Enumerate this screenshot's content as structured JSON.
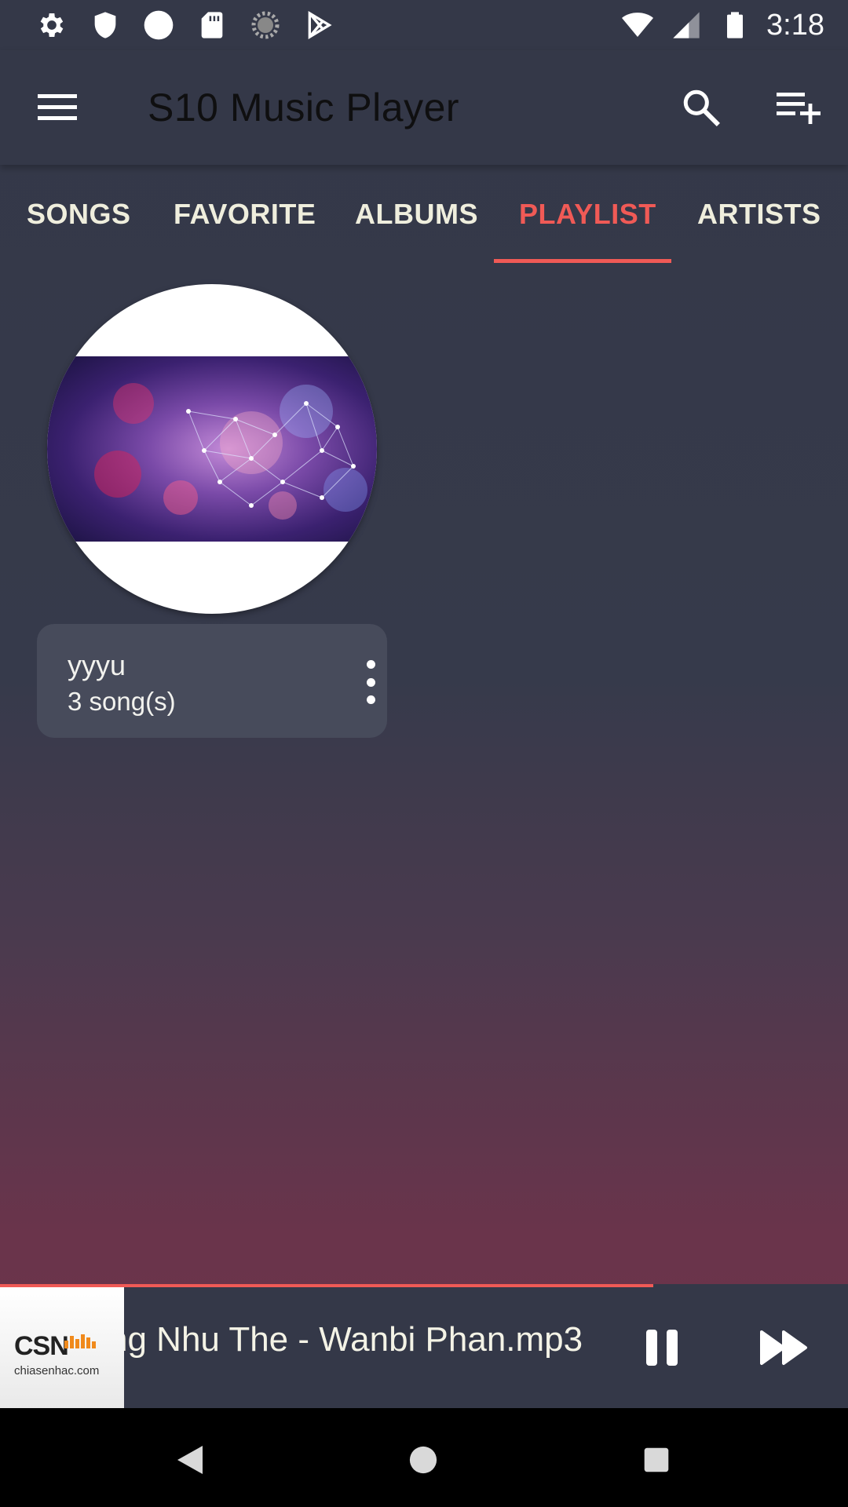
{
  "status_bar": {
    "time": "3:18",
    "left_icons": [
      "gear-icon",
      "shield-icon",
      "circle-icon",
      "sd-card-icon",
      "sync-icon",
      "play-store-icon"
    ],
    "right_icons": [
      "wifi-icon",
      "signal-icon",
      "battery-icon"
    ]
  },
  "app_bar": {
    "title": "S10 Music Player",
    "menu_icon": "hamburger-menu-icon",
    "search_icon": "search-icon",
    "add_playlist_icon": "playlist-add-icon"
  },
  "tabs": [
    {
      "label": "SONGS",
      "active": false
    },
    {
      "label": "FAVORITE",
      "active": false
    },
    {
      "label": "ALBUMS",
      "active": false
    },
    {
      "label": "PLAYLIST",
      "active": true
    },
    {
      "label": "ARTISTS",
      "active": false
    }
  ],
  "playlists": [
    {
      "name": "yyyu",
      "count": "3 song(s)"
    }
  ],
  "now_playing": {
    "title": "ng Nhu The - Wanbi Phan.mp3",
    "thumb_logo": "CSN",
    "thumb_domain": "chiasenhac.com",
    "progress": 0.77
  },
  "colors": {
    "accent": "#f05a56",
    "background_top": "#343848",
    "background_bottom": "#6e3349",
    "card": "#474b5b",
    "tab_text": "#efeedd"
  }
}
